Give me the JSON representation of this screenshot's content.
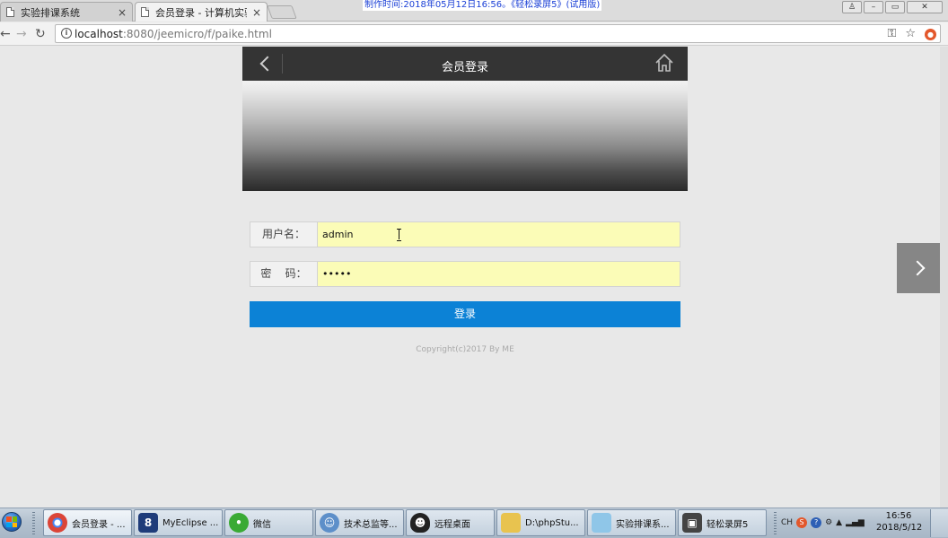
{
  "browser": {
    "tabs": [
      {
        "label": "实验排课系统",
        "active": false
      },
      {
        "label": "会员登录 - 计算机实验中",
        "active": true
      }
    ],
    "tab_close_glyph": "×",
    "recording_banner": "制作时间:2018年05月12日16:56。《轻松录屏5》(试用版)",
    "window_controls": {
      "user": "♙",
      "minimize": "–",
      "restore": "▭",
      "close": "✕"
    },
    "nav": {
      "back": "←",
      "forward": "→",
      "reload": "↻"
    },
    "address": {
      "host": "localhost",
      "rest": ":8080/jeemicro/f/paike.html"
    },
    "omnibox_icons": [
      "key-icon",
      "star-icon",
      "extension-icon"
    ]
  },
  "page": {
    "header": {
      "title": "会员登录"
    },
    "form": {
      "username_label": "用户名：",
      "username_value": "admin",
      "password_label": "密    码：",
      "password_value": "12345"
    },
    "login_button": "登录",
    "copyright": "Copyright(c)2017 By ME"
  },
  "taskbar": {
    "tasks": [
      {
        "label": "会员登录 - ...",
        "icon": "chrome-icon",
        "active": true
      },
      {
        "label": "MyEclipse ...",
        "icon": "myeclipse-icon",
        "active": false
      },
      {
        "label": "微信",
        "icon": "wechat-icon",
        "active": false
      },
      {
        "label": "技术总监等...",
        "icon": "qq-group-icon",
        "active": false
      },
      {
        "label": "远程桌面",
        "icon": "qq-icon",
        "active": false
      },
      {
        "label": "D:\\phpStu...",
        "icon": "folder-icon",
        "active": false
      },
      {
        "label": "实验排课系...",
        "icon": "notepad-icon",
        "active": false
      },
      {
        "label": "轻松录屏5",
        "icon": "recorder-icon",
        "active": false
      }
    ],
    "tray": {
      "lang": "CH",
      "time": "16:56",
      "date": "2018/5/12"
    }
  }
}
